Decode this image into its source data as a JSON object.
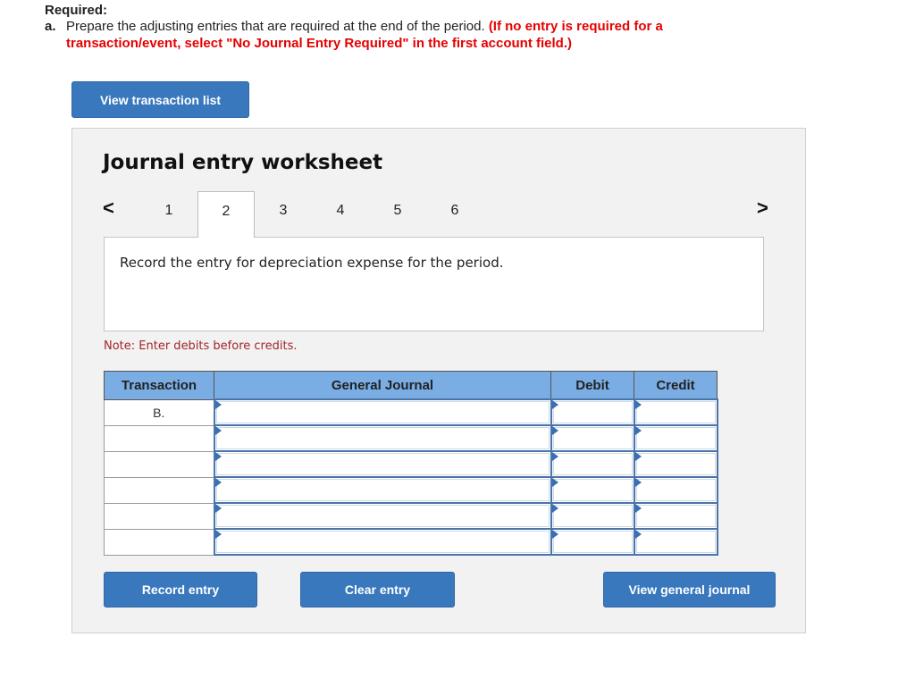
{
  "required": {
    "title": "Required:",
    "item_label": "a.",
    "instruction": "Prepare the adjusting entries that are required at the end of the period.",
    "highlight_line1": "(If no entry is required for a",
    "highlight_line2": "transaction/event, select \"No Journal Entry Required\" in the first account field.)"
  },
  "buttons": {
    "view_transaction_list": "View transaction list",
    "record_entry": "Record entry",
    "clear_entry": "Clear entry",
    "view_general_journal": "View general journal"
  },
  "worksheet": {
    "title": "Journal entry worksheet",
    "nav_prev": "<",
    "nav_next": ">",
    "tabs": [
      "1",
      "2",
      "3",
      "4",
      "5",
      "6"
    ],
    "active_tab": "2",
    "description": "Record the entry for depreciation expense for the period.",
    "note": "Note: Enter debits before credits."
  },
  "table": {
    "headers": {
      "transaction": "Transaction",
      "general_journal": "General Journal",
      "debit": "Debit",
      "credit": "Credit"
    },
    "rows": [
      {
        "transaction": "B.",
        "account": "",
        "debit": "",
        "credit": ""
      },
      {
        "transaction": "",
        "account": "",
        "debit": "",
        "credit": ""
      },
      {
        "transaction": "",
        "account": "",
        "debit": "",
        "credit": ""
      },
      {
        "transaction": "",
        "account": "",
        "debit": "",
        "credit": ""
      },
      {
        "transaction": "",
        "account": "",
        "debit": "",
        "credit": ""
      },
      {
        "transaction": "",
        "account": "",
        "debit": "",
        "credit": ""
      }
    ]
  },
  "colors": {
    "button_blue": "#3a78bd",
    "header_blue": "#7aade3",
    "instruction_red": "#e60000",
    "note_red": "#a3262b"
  }
}
